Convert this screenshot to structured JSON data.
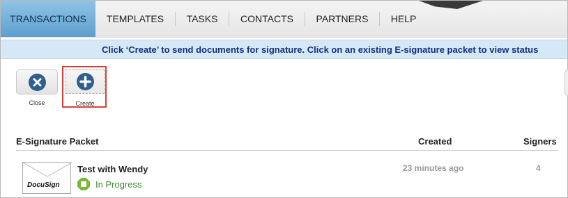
{
  "nav": {
    "tabs": [
      {
        "label": "TRANSACTIONS",
        "active": true
      },
      {
        "label": "TEMPLATES",
        "active": false
      },
      {
        "label": "TASKS",
        "active": false
      },
      {
        "label": "CONTACTS",
        "active": false
      },
      {
        "label": "PARTNERS",
        "active": false
      },
      {
        "label": "HELP",
        "active": false
      }
    ]
  },
  "banner": {
    "text": "Click ‘Create’ to send documents for signature. Click on an existing E-signature packet to view status"
  },
  "toolbar": {
    "close_label": "Close",
    "close_icon": "close-icon",
    "create_label": "Create",
    "create_icon": "plus-icon"
  },
  "table": {
    "headers": {
      "packet": "E-Signature Packet",
      "created": "Created",
      "signers": "Signers"
    },
    "rows": [
      {
        "title": "Test with Wendy",
        "status": "In Progress",
        "created": "23 minutes ago",
        "signers": "4",
        "thumbnail_logo": "DocuSign"
      }
    ]
  },
  "colors": {
    "active_tab": "#5e9fcf",
    "banner_bg": "#d6e8f6",
    "banner_text": "#12307a",
    "icon_blue": "#2f5f8a",
    "highlight": "#d9403a",
    "status_green": "#7ab83a"
  }
}
